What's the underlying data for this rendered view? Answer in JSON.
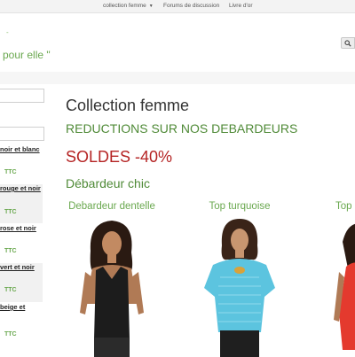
{
  "nav": {
    "items": [
      {
        "label": "collection femme",
        "caret": "▼"
      },
      {
        "label": "Forums de discussion"
      },
      {
        "label": "Livre d'or"
      }
    ]
  },
  "header": {
    "dash": "-",
    "tagline": "pour elle \""
  },
  "search": {
    "icon": "search-icon"
  },
  "sidebar": {
    "products": [
      {
        "title": "noir et blanc",
        "price": "TTC"
      },
      {
        "title": "rouge et noir",
        "price": "TTC"
      },
      {
        "title": "rose et noir",
        "price": "TTC"
      },
      {
        "title": "vert et noir",
        "price": "TTC"
      },
      {
        "title": "beige et",
        "price": "TTC"
      }
    ]
  },
  "main": {
    "page_title": "Collection femme",
    "promo_heading": "REDUCTIONS SUR NOS DEBARDEURS",
    "sale_heading": "SOLDES -40%",
    "section_heading": "Débardeur chic",
    "products": [
      {
        "title": "Debardeur dentelle",
        "color": "#1c1c1c"
      },
      {
        "title": "Top turquoise",
        "color": "#5cc4df"
      },
      {
        "title": "Top",
        "color": "#e43a2e"
      }
    ]
  },
  "colors": {
    "accent_green": "#6aa84f",
    "sale_red": "#b52424",
    "turquoise": "#5cc4df"
  }
}
